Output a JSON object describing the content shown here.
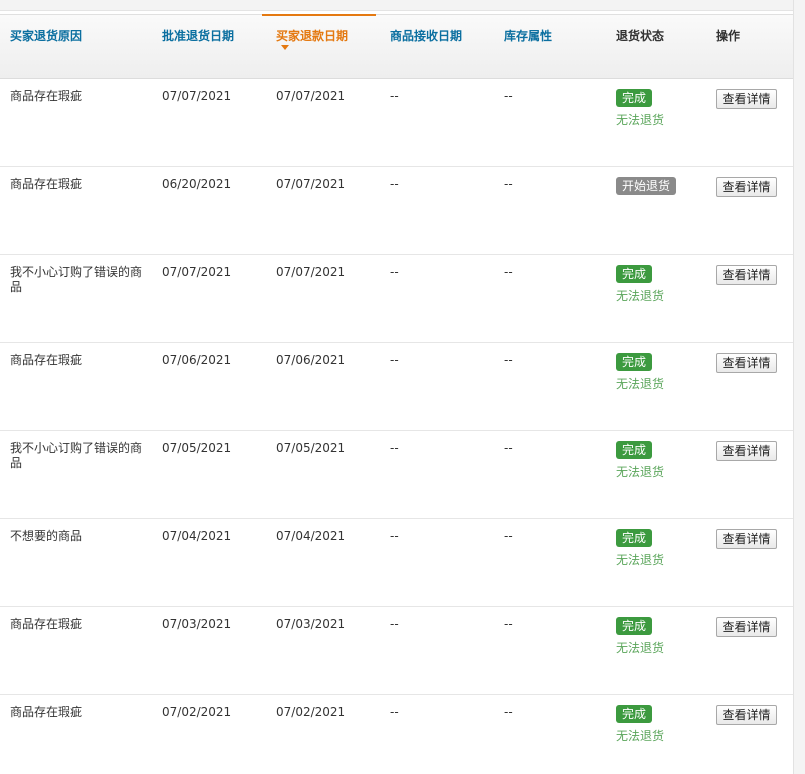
{
  "table": {
    "columns": [
      {
        "label": "买家退货原因"
      },
      {
        "label": "批准退货日期"
      },
      {
        "label": "买家退款日期"
      },
      {
        "label": "商品接收日期"
      },
      {
        "label": "库存属性"
      },
      {
        "label": "退货状态"
      },
      {
        "label": "操作"
      }
    ],
    "rows": [
      {
        "reason": "商品存在瑕疵",
        "approve_date": "07/07/2021",
        "refund_date": "07/07/2021",
        "receive_date": "--",
        "stock": "--",
        "status": "完成",
        "status_color": "#3c9a3f",
        "sub_status": "无法退货",
        "action": "查看详情"
      },
      {
        "reason": "商品存在瑕疵",
        "approve_date": "06/20/2021",
        "refund_date": "07/07/2021",
        "receive_date": "--",
        "stock": "--",
        "status": "开始退货",
        "status_color": "#8a8a8a",
        "sub_status": "",
        "action": "查看详情"
      },
      {
        "reason": "我不小心订购了错误的商品",
        "approve_date": "07/07/2021",
        "refund_date": "07/07/2021",
        "receive_date": "--",
        "stock": "--",
        "status": "完成",
        "status_color": "#3c9a3f",
        "sub_status": "无法退货",
        "action": "查看详情"
      },
      {
        "reason": "商品存在瑕疵",
        "approve_date": "07/06/2021",
        "refund_date": "07/06/2021",
        "receive_date": "--",
        "stock": "--",
        "status": "完成",
        "status_color": "#3c9a3f",
        "sub_status": "无法退货",
        "action": "查看详情"
      },
      {
        "reason": "我不小心订购了错误的商品",
        "approve_date": "07/05/2021",
        "refund_date": "07/05/2021",
        "receive_date": "--",
        "stock": "--",
        "status": "完成",
        "status_color": "#3c9a3f",
        "sub_status": "无法退货",
        "action": "查看详情"
      },
      {
        "reason": "不想要的商品",
        "approve_date": "07/04/2021",
        "refund_date": "07/04/2021",
        "receive_date": "--",
        "stock": "--",
        "status": "完成",
        "status_color": "#3c9a3f",
        "sub_status": "无法退货",
        "action": "查看详情"
      },
      {
        "reason": "商品存在瑕疵",
        "approve_date": "07/03/2021",
        "refund_date": "07/03/2021",
        "receive_date": "--",
        "stock": "--",
        "status": "完成",
        "status_color": "#3c9a3f",
        "sub_status": "无法退货",
        "action": "查看详情"
      },
      {
        "reason": "商品存在瑕疵",
        "approve_date": "07/02/2021",
        "refund_date": "07/02/2021",
        "receive_date": "--",
        "stock": "--",
        "status": "完成",
        "status_color": "#3c9a3f",
        "sub_status": "无法退货",
        "action": "查看详情"
      }
    ]
  },
  "colors": {
    "header_link": "#0b6fa0",
    "active_sort": "#e47911",
    "status_complete": "#3c9a3f",
    "status_started": "#8a8a8a",
    "sub_status_text": "#5aa55a"
  },
  "icons": {
    "sort": "sort-descending-icon"
  }
}
